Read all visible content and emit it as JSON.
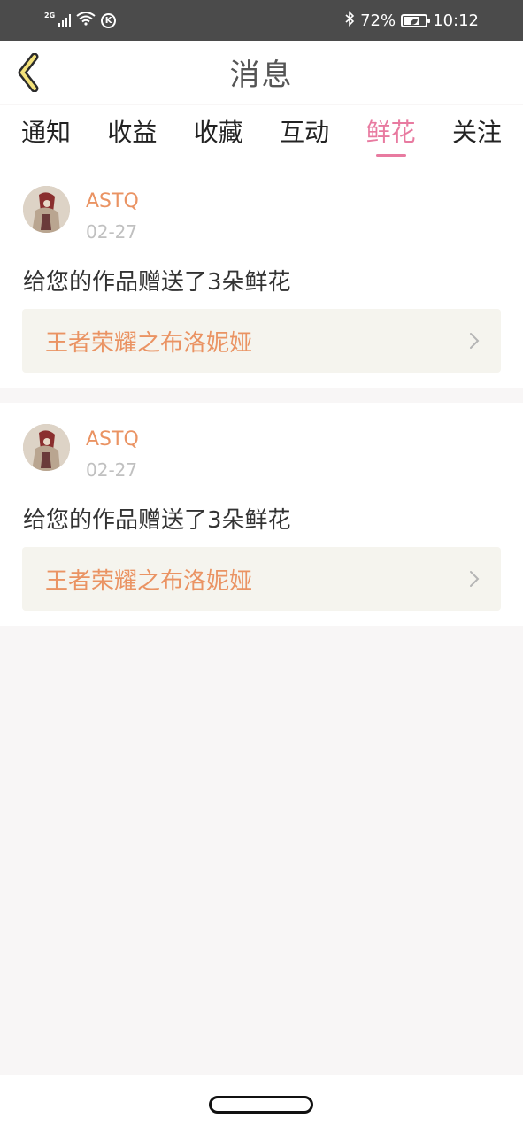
{
  "status_bar": {
    "network": "2G",
    "battery": "72%",
    "battery_level": 0.72,
    "time": "10:12",
    "icons": [
      "signal-icon",
      "wifi-icon",
      "k-app-icon",
      "bluetooth-icon",
      "battery-icon"
    ]
  },
  "header": {
    "title": "消息",
    "back_icon": "chevron-left-icon"
  },
  "tabs": [
    {
      "label": "通知",
      "active": false
    },
    {
      "label": "收益",
      "active": false
    },
    {
      "label": "收藏",
      "active": false
    },
    {
      "label": "互动",
      "active": false
    },
    {
      "label": "鲜花",
      "active": true
    },
    {
      "label": "关注",
      "active": false
    }
  ],
  "messages": [
    {
      "user": "ASTQ",
      "date": "02-27",
      "text": "给您的作品赠送了3朵鲜花",
      "work_title": "王者荣耀之布洛妮娅"
    },
    {
      "user": "ASTQ",
      "date": "02-27",
      "text": "给您的作品赠送了3朵鲜花",
      "work_title": "王者荣耀之布洛妮娅"
    }
  ],
  "colors": {
    "accent": "#e87aa0",
    "username": "#ea9363",
    "work_bg": "#f5f4ee",
    "status_bar_bg": "#4b4b4b"
  }
}
